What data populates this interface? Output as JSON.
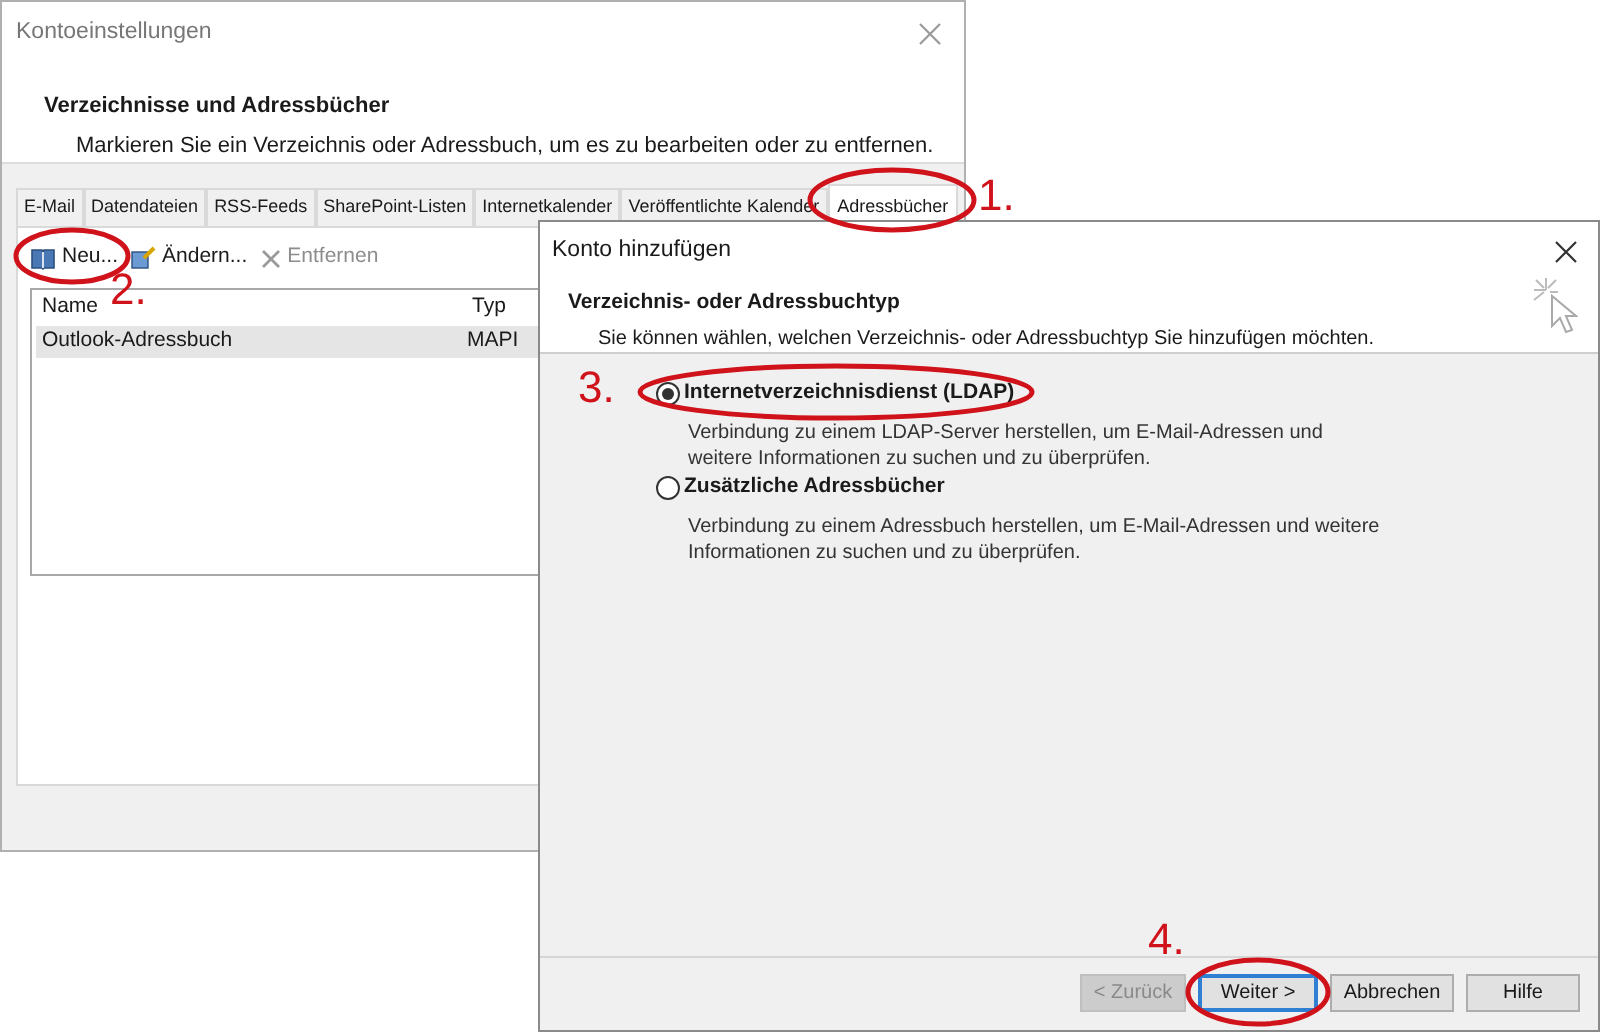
{
  "back_window": {
    "title": "Kontoeinstellungen",
    "heading": "Verzeichnisse und Adressbücher",
    "description": "Markieren Sie ein Verzeichnis oder Adressbuch, um es zu bearbeiten oder zu entfernen.",
    "tabs": [
      {
        "label": "E-Mail",
        "selected": false
      },
      {
        "label": "Datendateien",
        "selected": false
      },
      {
        "label": "RSS-Feeds",
        "selected": false
      },
      {
        "label": "SharePoint-Listen",
        "selected": false
      },
      {
        "label": "Internetkalender",
        "selected": false
      },
      {
        "label": "Veröffentlichte Kalender",
        "selected": false
      },
      {
        "label": "Adressbücher",
        "selected": true
      }
    ],
    "toolbar": [
      {
        "kind": "book",
        "label": "Neu...",
        "disabled": false
      },
      {
        "kind": "edit",
        "label": "Ändern...",
        "disabled": false
      },
      {
        "kind": "remove",
        "label": "Entfernen",
        "disabled": true
      }
    ],
    "table": {
      "columns": [
        "Name",
        "Typ"
      ],
      "rows": [
        {
          "cells": [
            "Outlook-Adressbuch",
            "MAPI"
          ],
          "selected": true
        }
      ]
    }
  },
  "dialog": {
    "title": "Konto hinzufügen",
    "heading": "Verzeichnis- oder Adressbuchtyp",
    "description": "Sie können wählen, welchen Verzeichnis- oder Adressbuchtyp Sie hinzufügen möchten.",
    "options": [
      {
        "label": "Internetverzeichnisdienst (LDAP)",
        "selected": true,
        "description_lines": [
          "Verbindung zu einem LDAP-Server herstellen, um E-Mail-Adressen und",
          "weitere Informationen zu suchen und zu überprüfen."
        ]
      },
      {
        "label": "Zusätzliche Adressbücher",
        "selected": false,
        "description_lines": [
          "Verbindung zu einem Adressbuch herstellen, um E-Mail-Adressen und weitere",
          "Informationen zu suchen und zu überprüfen."
        ]
      }
    ],
    "buttons": [
      {
        "label": "< Zurück",
        "disabled": true,
        "default": false
      },
      {
        "label": "Weiter >",
        "disabled": false,
        "default": true
      },
      {
        "label": "Abbrechen",
        "disabled": false,
        "default": false
      },
      {
        "label": "Hilfe",
        "disabled": false,
        "default": false
      }
    ]
  },
  "annotations": [
    "1.",
    "2.",
    "3.",
    "4."
  ]
}
